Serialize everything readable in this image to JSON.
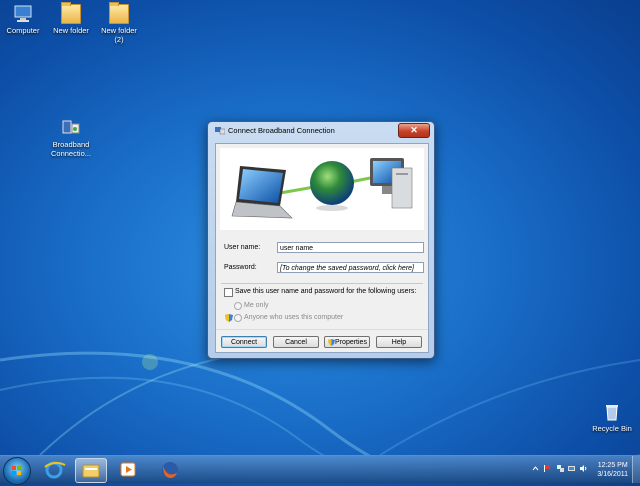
{
  "desktop": {
    "icons": [
      {
        "label": "Computer"
      },
      {
        "label": "New folder"
      },
      {
        "label": "New folder (2)"
      },
      {
        "label": "Broadband Connectio..."
      },
      {
        "label": "Recycle Bin"
      }
    ]
  },
  "dialog": {
    "title": "Connect Broadband Connection",
    "close_label": "✕",
    "username_label": "User name:",
    "username_value": "user name",
    "password_label": "Password:",
    "password_hint": "[To change the saved password, click here]",
    "save_checkbox_label": "Save this user name and password for the following users:",
    "save_checked": false,
    "radio_me_only": "Me only",
    "radio_anyone": "Anyone who uses this computer",
    "buttons": {
      "connect": "Connect",
      "cancel": "Cancel",
      "properties": "Properties",
      "help": "Help"
    }
  },
  "taskbar": {
    "time": "12:25 PM",
    "date": "3/16/2011",
    "pinned": [
      "internet-explorer-icon",
      "windows-explorer-icon",
      "media-player-icon",
      "firefox-icon"
    ]
  },
  "colors": {
    "desktop_blue": "#1a6fc9",
    "dialog_frame": "#b5cde9",
    "close_red": "#c7432a",
    "default_button_border": "#3c7fb1"
  }
}
